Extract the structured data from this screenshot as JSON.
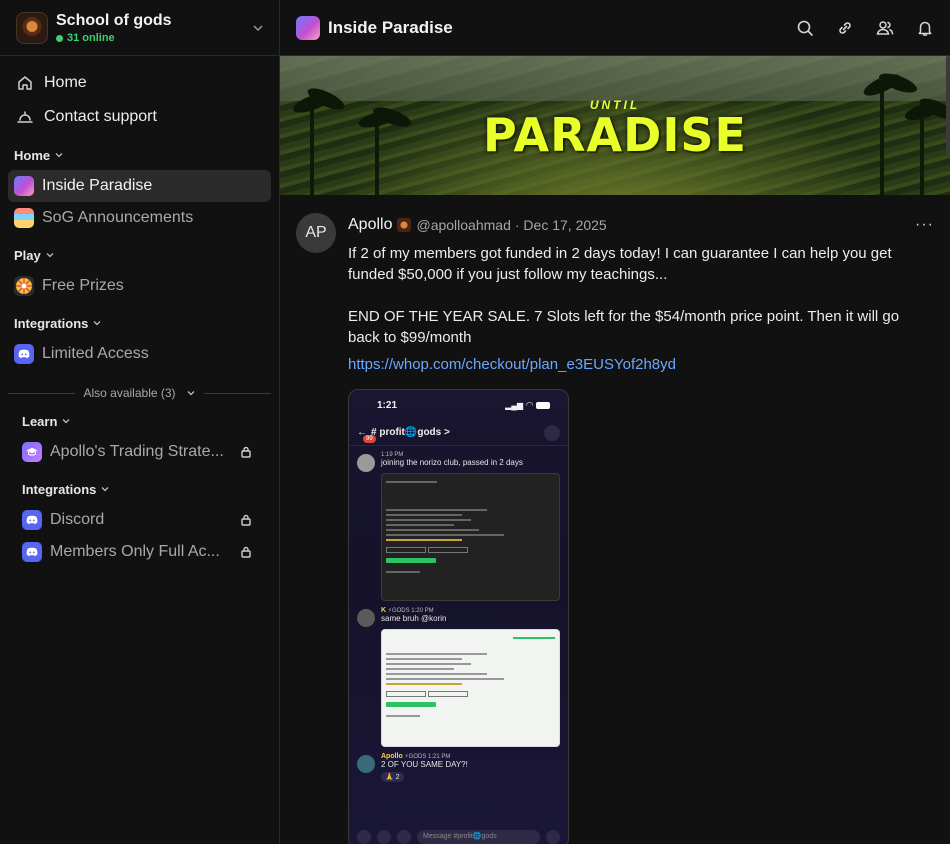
{
  "workspace": {
    "name": "School of gods",
    "online": "31 online"
  },
  "sidebar": {
    "top_items": [
      {
        "label": "Home",
        "icon": "home-icon"
      },
      {
        "label": "Contact support",
        "icon": "bell-icon"
      }
    ],
    "sections": [
      {
        "title": "Home",
        "channels": [
          {
            "label": "Inside Paradise",
            "active": true
          },
          {
            "label": "SoG Announcements"
          }
        ]
      },
      {
        "title": "Play",
        "channels": [
          {
            "label": "Free Prizes"
          }
        ]
      },
      {
        "title": "Integrations",
        "channels": [
          {
            "label": "Limited Access"
          }
        ]
      }
    ],
    "also_available": "Also available (3)",
    "locked_sections": [
      {
        "title": "Learn",
        "channels": [
          {
            "label": "Apollo's Trading Strate..."
          }
        ]
      },
      {
        "title": "Integrations",
        "channels": [
          {
            "label": "Discord"
          },
          {
            "label": "Members Only Full Ac..."
          }
        ]
      }
    ]
  },
  "header": {
    "title": "Inside Paradise"
  },
  "banner": {
    "small_text": "UNTIL",
    "title": "PARADISE"
  },
  "post": {
    "avatar_initials": "AP",
    "author": "Apollo",
    "handle": "@apolloahmad",
    "date": "· Dec 17, 2025",
    "more": "···",
    "paragraph1": "If 2 of my members got funded in 2 days today! I can guarantee I can help you get funded $50,000 if you just follow my teachings...",
    "paragraph2": "END OF THE YEAR SALE. 7 Slots left for the $54/month price point. Then it will go back to $99/month",
    "link": "https://whop.com/checkout/plan_e3EUSYof2h8yd"
  },
  "phone": {
    "time": "1:21",
    "channel": "# profit🌐gods >",
    "badge": "99",
    "msg1_name": "1:19 PM",
    "msg1_text": "joining the norizo club, passed in 2 days",
    "msg2_name": "K",
    "msg2_tag": "⚡GODS",
    "msg2_time": "1:20 PM",
    "msg2_text": "same bruh @korin",
    "msg3_name": "Apollo",
    "msg3_tag": "⚡GODS",
    "msg3_time": "1:21 PM",
    "msg3_text": "2 OF YOU SAME DAY?!",
    "msg3_react": "🙏 2",
    "input_placeholder": "Message #profit🌐gods"
  },
  "colors": {
    "accent_online": "#3ecf6e",
    "link": "#6aa8ff",
    "active_bg": "#2b2b2b",
    "banner_text": "#e8ff2a"
  }
}
